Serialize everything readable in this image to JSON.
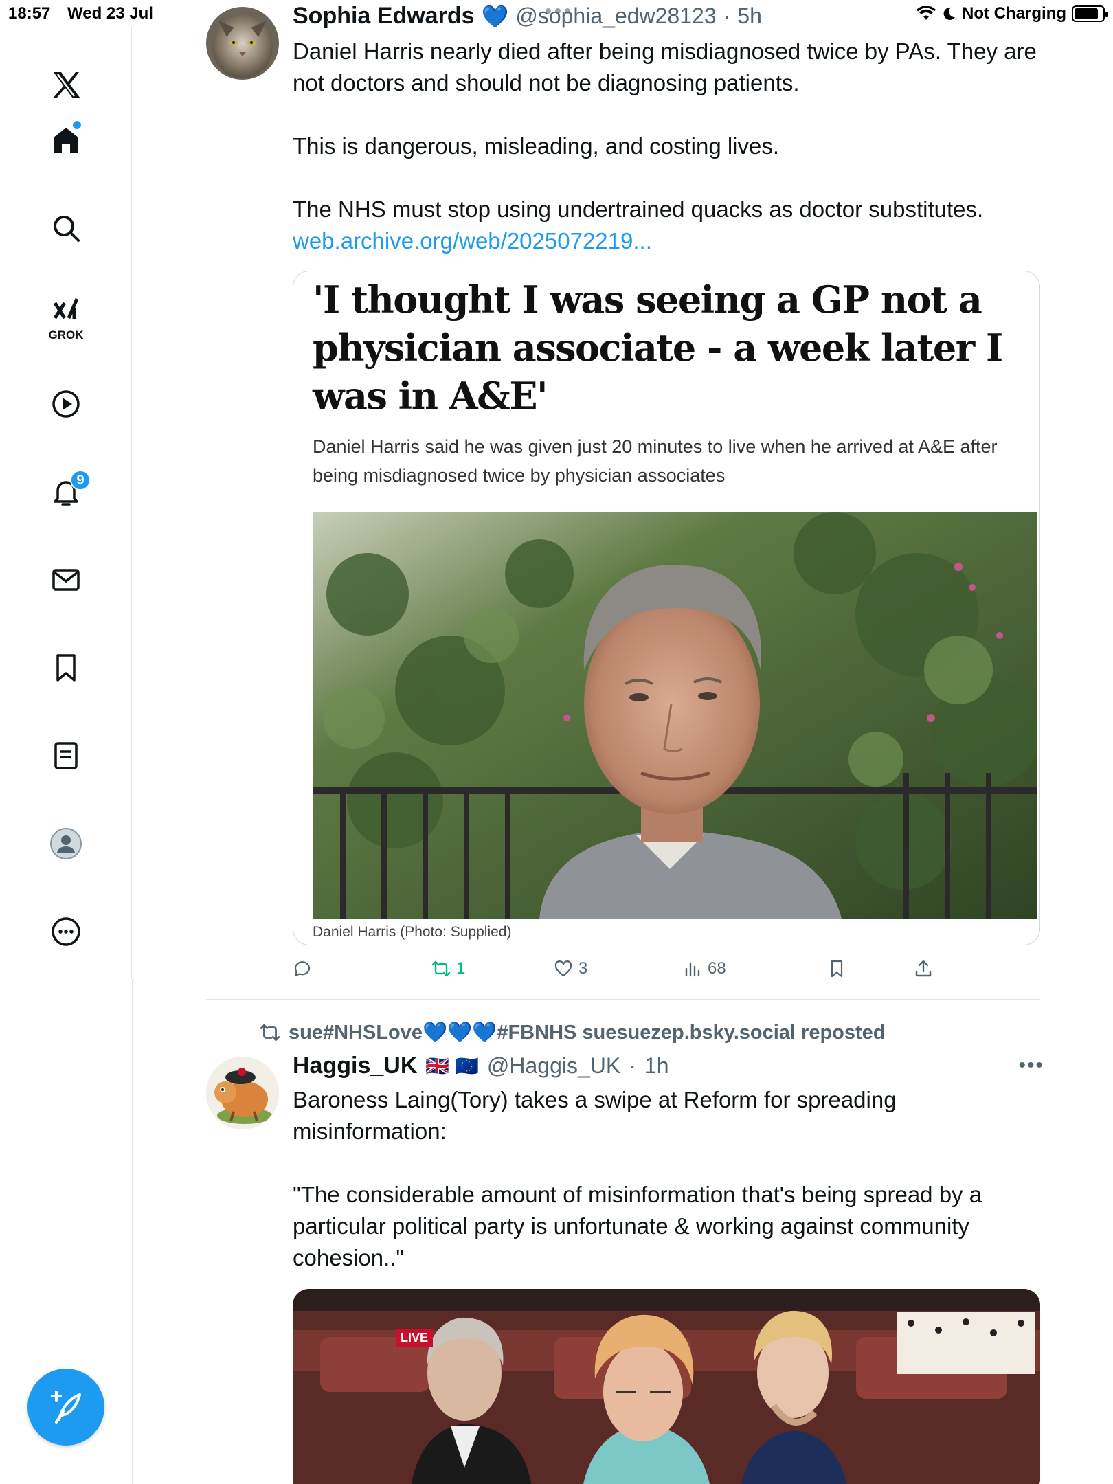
{
  "status_bar": {
    "time": "18:57",
    "date": "Wed 23 Jul",
    "charging": "Not Charging"
  },
  "sidebar": {
    "grok_label": "GROK",
    "notifications_count": "9"
  },
  "colors": {
    "accent": "#1d9bf0",
    "retweet_green": "#00ba7c",
    "verified": "#1d6ff2"
  },
  "tweets": [
    {
      "name": "Sophia Edwards",
      "verified_emoji": "💙",
      "handle": "@sophia_edw28123",
      "sep": "·",
      "time": "5h",
      "paragraphs": [
        "Daniel Harris nearly died after being misdiagnosed twice by PAs. They are not doctors and should not be diagnosing patients.",
        "This is dangerous, misleading, and costing lives.",
        "The NHS must stop using undertrained quacks as doctor substitutes."
      ],
      "link": "web.archive.org/web/2025072219...",
      "card": {
        "headline": "'I thought I was seeing a GP not a physician associate - a week later I was in A&E'",
        "subheadline": "Daniel Harris said he was given just 20 minutes to live when he arrived at A&E after being misdiagnosed twice by physician associates",
        "caption": "Daniel Harris (Photo: Supplied)"
      },
      "actions": {
        "replies": "",
        "reposts": "1",
        "likes": "3",
        "views": "68"
      }
    },
    {
      "reposted_by": "sue#NHSLove💙💙💙#FBNHS suesuezep.bsky.social reposted",
      "name": "Haggis_UK",
      "flags": "🇬🇧 🇪🇺",
      "handle": "@Haggis_UK",
      "sep": "·",
      "time": "1h",
      "paragraphs": [
        "Baroness Laing(Tory) takes a swipe at Reform for spreading misinformation:",
        "\"The considerable amount of misinformation that's being spread by a particular political party is unfortunate & working against community cohesion..\""
      ],
      "video": {
        "live_label": "LIVE"
      }
    }
  ]
}
